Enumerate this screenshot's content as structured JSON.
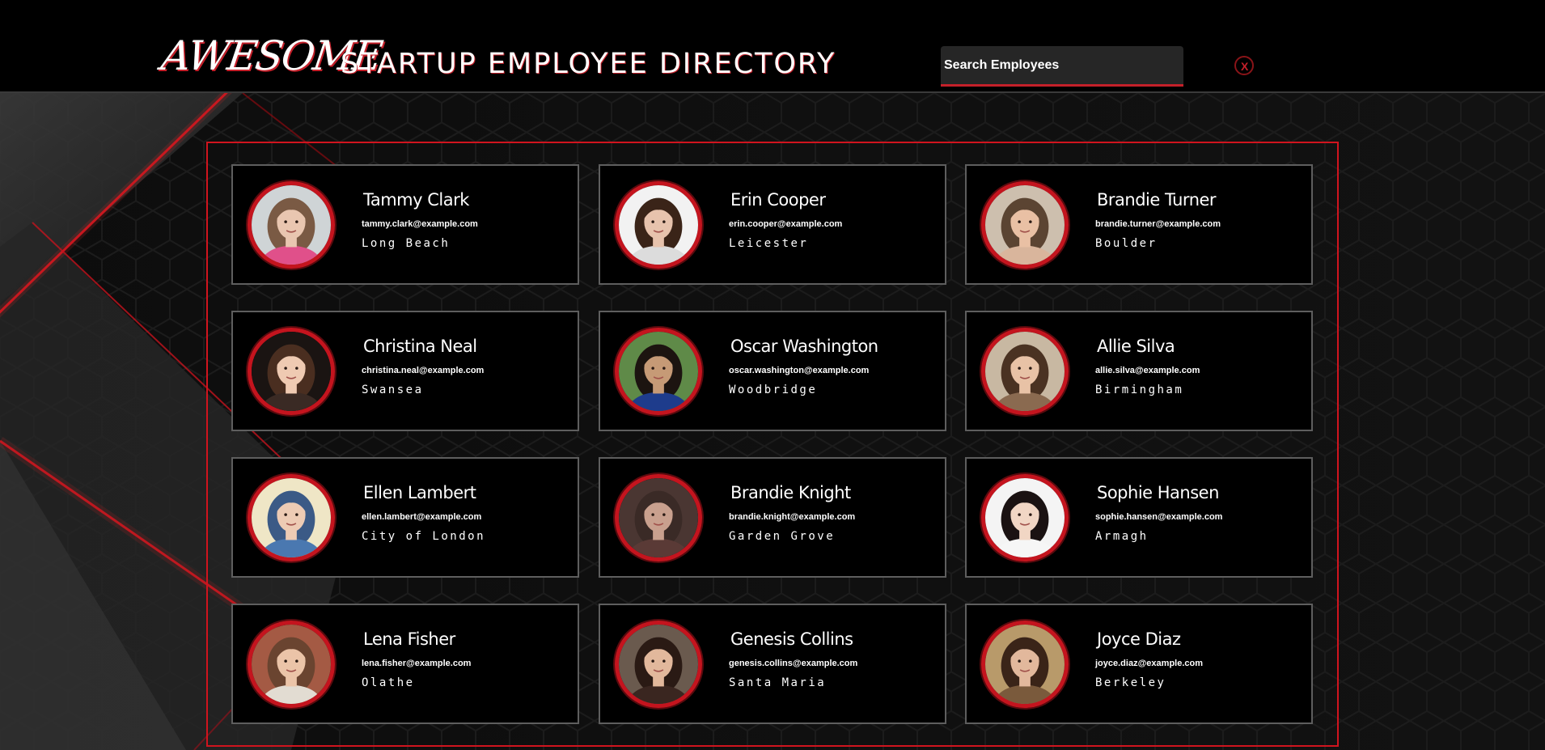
{
  "header": {
    "logo_script": "AWESOME",
    "logo_text": "STARTUP EMPLOYEE DIRECTORY",
    "search_placeholder": "Search Employees",
    "clear_label": "X"
  },
  "colors": {
    "accent": "#c4202a",
    "card_border": "#5e5e5e",
    "background": "#000000"
  },
  "employees": [
    {
      "name": "Tammy Clark",
      "email": "tammy.clark@example.com",
      "city": "Long Beach",
      "skin": "#e9c6b0",
      "hair": "#7a5a44",
      "shirt": "#e0508a",
      "bg": "#cfd4d6"
    },
    {
      "name": "Erin Cooper",
      "email": "erin.cooper@example.com",
      "city": "Leicester",
      "skin": "#e7c3ad",
      "hair": "#3a2418",
      "shirt": "#dcdcdc",
      "bg": "#f2f2f2"
    },
    {
      "name": "Brandie Turner",
      "email": "brandie.turner@example.com",
      "city": "Boulder",
      "skin": "#e9c0a4",
      "hair": "#5b4432",
      "shirt": "#d9b59c",
      "bg": "#cdbfae"
    },
    {
      "name": "Christina Neal",
      "email": "christina.neal@example.com",
      "city": "Swansea",
      "skin": "#efcab2",
      "hair": "#4a2e20",
      "shirt": "#3a2a24",
      "bg": "#1a1412"
    },
    {
      "name": "Oscar Washington",
      "email": "oscar.washington@example.com",
      "city": "Woodbridge",
      "skin": "#c69a76",
      "hair": "#1c1410",
      "shirt": "#1e3c8c",
      "bg": "#5f8a48"
    },
    {
      "name": "Allie Silva",
      "email": "allie.silva@example.com",
      "city": "Birmingham",
      "skin": "#e8c2a6",
      "hair": "#4a3222",
      "shirt": "#8a6a50",
      "bg": "#c8b8a2"
    },
    {
      "name": "Ellen Lambert",
      "email": "ellen.lambert@example.com",
      "city": "City of London",
      "skin": "#edcbb4",
      "hair": "#3b5a86",
      "shirt": "#4a78b0",
      "bg": "#efe6c6"
    },
    {
      "name": "Brandie Knight",
      "email": "brandie.knight@example.com",
      "city": "Garden Grove",
      "skin": "#c9a08e",
      "hair": "#3a2a26",
      "shirt": "#5a3a36",
      "bg": "#4a3632"
    },
    {
      "name": "Sophie Hansen",
      "email": "sophie.hansen@example.com",
      "city": "Armagh",
      "skin": "#f1d6c4",
      "hair": "#1a1212",
      "shirt": "#f6f6f6",
      "bg": "#f4f4f4"
    },
    {
      "name": "Lena Fisher",
      "email": "lena.fisher@example.com",
      "city": "Olathe",
      "skin": "#ebc4a8",
      "hair": "#6a4430",
      "shirt": "#e2dcd2",
      "bg": "#a45a44"
    },
    {
      "name": "Genesis Collins",
      "email": "genesis.collins@example.com",
      "city": "Santa Maria",
      "skin": "#e2b89c",
      "hair": "#2a1a14",
      "shirt": "#3a2620",
      "bg": "#6a5a4e"
    },
    {
      "name": "Joyce Diaz",
      "email": "joyce.diaz@example.com",
      "city": "Berkeley",
      "skin": "#e2b89c",
      "hair": "#3a2418",
      "shirt": "#7a5a3c",
      "bg": "#b89a6a"
    }
  ]
}
